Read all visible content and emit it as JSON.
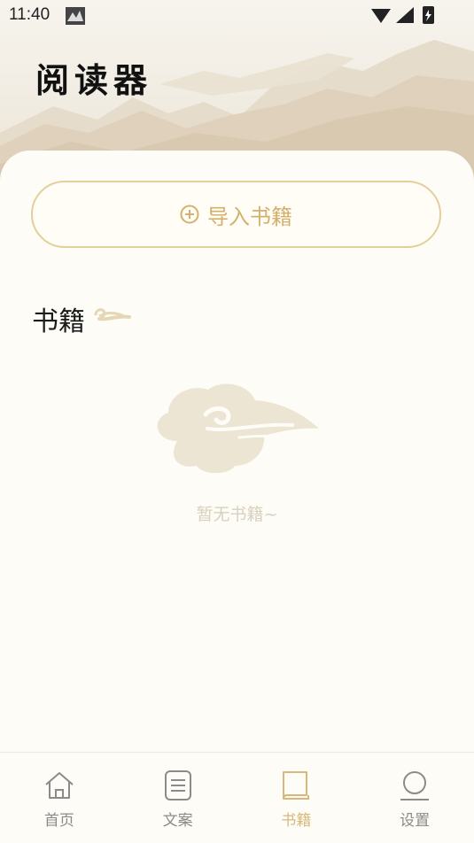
{
  "status_bar": {
    "time": "11:40"
  },
  "header": {
    "title": "阅读器"
  },
  "import_button": {
    "label": "导入书籍",
    "icon": "plus-circle-icon"
  },
  "section": {
    "title": "书籍",
    "decoration": "cloud-swirl-icon"
  },
  "empty_state": {
    "text": "暂无书籍~",
    "illustration": "cloud-icon"
  },
  "bottom_nav": {
    "items": [
      {
        "label": "首页",
        "icon": "home-icon",
        "active": false
      },
      {
        "label": "文案",
        "icon": "document-icon",
        "active": false
      },
      {
        "label": "书籍",
        "icon": "book-icon",
        "active": true
      },
      {
        "label": "设置",
        "icon": "settings-icon",
        "active": false
      }
    ]
  },
  "colors": {
    "accent": "#d3b16c",
    "active_tab": "#d8b77a",
    "background": "#fdfcf7"
  }
}
